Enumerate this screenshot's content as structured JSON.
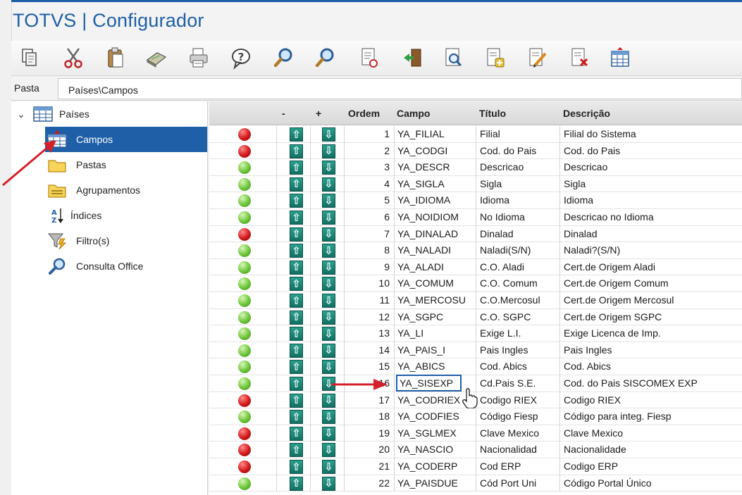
{
  "app": {
    "title": "TOTVS | Configurador"
  },
  "toolbar": {
    "buttons": [
      {
        "icon": "copy-icon"
      },
      {
        "icon": "cut-icon"
      },
      {
        "icon": "paste-icon"
      },
      {
        "icon": "eraser-icon"
      },
      {
        "icon": "print-icon"
      },
      {
        "icon": "help-icon"
      },
      {
        "icon": "search-icon"
      },
      {
        "icon": "search-next-icon"
      },
      {
        "icon": "document-check-icon"
      },
      {
        "icon": "exit-icon"
      },
      {
        "icon": "preview-icon"
      },
      {
        "icon": "add-document-icon"
      },
      {
        "icon": "edit-document-icon"
      },
      {
        "icon": "delete-document-icon"
      },
      {
        "icon": "table-icon"
      }
    ]
  },
  "path": {
    "label": "Pasta",
    "value": "Países\\Campos"
  },
  "tree": {
    "root": {
      "label": "Países",
      "icon": "table-icon",
      "expand_icon": "chevron-down-icon"
    },
    "items": [
      {
        "label": "Campos",
        "icon": "fields-icon",
        "selected": true
      },
      {
        "label": "Pastas",
        "icon": "folder-icon"
      },
      {
        "label": "Agrupamentos",
        "icon": "group-folder-icon"
      },
      {
        "label": "Índices",
        "icon": "sort-az-icon"
      },
      {
        "label": "Filtro(s)",
        "icon": "filter-icon"
      },
      {
        "label": "Consulta Office",
        "icon": "magnifier-icon"
      }
    ]
  },
  "grid": {
    "columns": {
      "minus": "-",
      "plus": "+",
      "ordem": "Ordem",
      "campo": "Campo",
      "titulo": "Título",
      "descricao": "Descrição"
    },
    "rows": [
      {
        "status": "red",
        "ordem": "1",
        "campo": "YA_FILIAL",
        "titulo": "Filial",
        "descricao": "Filial do Sistema"
      },
      {
        "status": "red",
        "ordem": "2",
        "campo": "YA_CODGI",
        "titulo": "Cod. do Pais",
        "descricao": "Cod. do Pais"
      },
      {
        "status": "green",
        "ordem": "3",
        "campo": "YA_DESCR",
        "titulo": "Descricao",
        "descricao": "Descricao"
      },
      {
        "status": "green",
        "ordem": "4",
        "campo": "YA_SIGLA",
        "titulo": "Sigla",
        "descricao": "Sigla"
      },
      {
        "status": "green",
        "ordem": "5",
        "campo": "YA_IDIOMA",
        "titulo": "Idioma",
        "descricao": "Idioma"
      },
      {
        "status": "green",
        "ordem": "6",
        "campo": "YA_NOIDIOM",
        "titulo": "No Idioma",
        "descricao": "Descricao no Idioma"
      },
      {
        "status": "red",
        "ordem": "7",
        "campo": "YA_DINALAD",
        "titulo": "Dinalad",
        "descricao": "Dinalad"
      },
      {
        "status": "green",
        "ordem": "8",
        "campo": "YA_NALADI",
        "titulo": "Naladi(S/N)",
        "descricao": "Naladi?(S/N)"
      },
      {
        "status": "green",
        "ordem": "9",
        "campo": "YA_ALADI",
        "titulo": "C.O. Aladi",
        "descricao": "Cert.de Origem Aladi"
      },
      {
        "status": "green",
        "ordem": "10",
        "campo": "YA_COMUM",
        "titulo": "C.O. Comum",
        "descricao": "Cert.de Origem Comum"
      },
      {
        "status": "green",
        "ordem": "11",
        "campo": "YA_MERCOSU",
        "titulo": "C.O.Mercosul",
        "descricao": "Cert.de Origem Mercosul"
      },
      {
        "status": "green",
        "ordem": "12",
        "campo": "YA_SGPC",
        "titulo": "C.O. SGPC",
        "descricao": "Cert.de Origem SGPC"
      },
      {
        "status": "green",
        "ordem": "13",
        "campo": "YA_LI",
        "titulo": "Exige L.I.",
        "descricao": "Exige Licenca de Imp."
      },
      {
        "status": "green",
        "ordem": "14",
        "campo": "YA_PAIS_I",
        "titulo": "Pais Ingles",
        "descricao": "Pais Ingles"
      },
      {
        "status": "green",
        "ordem": "15",
        "campo": "YA_ABICS",
        "titulo": "Cod. Abics",
        "descricao": "Cod. Abics"
      },
      {
        "status": "green",
        "ordem": "16",
        "campo": "YA_SISEXP",
        "titulo": "Cd.Pais S.E.",
        "descricao": "Cod. do Pais SISCOMEX EXP",
        "selected": true
      },
      {
        "status": "red",
        "ordem": "17",
        "campo": "YA_CODRIEX",
        "titulo": "Codigo RIEX",
        "descricao": "Codigo RIEX"
      },
      {
        "status": "green",
        "ordem": "18",
        "campo": "YA_CODFIES",
        "titulo": "Código Fiesp",
        "descricao": "Código para integ. Fiesp"
      },
      {
        "status": "red",
        "ordem": "19",
        "campo": "YA_SGLMEX",
        "titulo": "Clave Mexico",
        "descricao": "Clave Mexico"
      },
      {
        "status": "red",
        "ordem": "20",
        "campo": "YA_NASCIO",
        "titulo": "Nacionalidad",
        "descricao": "Nacionalidade"
      },
      {
        "status": "red",
        "ordem": "21",
        "campo": "YA_CODERP",
        "titulo": "Cod ERP",
        "descricao": "Codigo ERP"
      },
      {
        "status": "green",
        "ordem": "22",
        "campo": "YA_PAISDUE",
        "titulo": "Cód Port Uni",
        "descricao": "Código Portal Único"
      }
    ]
  },
  "colors": {
    "accent": "#1f5fa8",
    "red": "#d11818",
    "green": "#6cc63a",
    "move_button": "#117062",
    "annotation_arrow": "#d4202a"
  }
}
